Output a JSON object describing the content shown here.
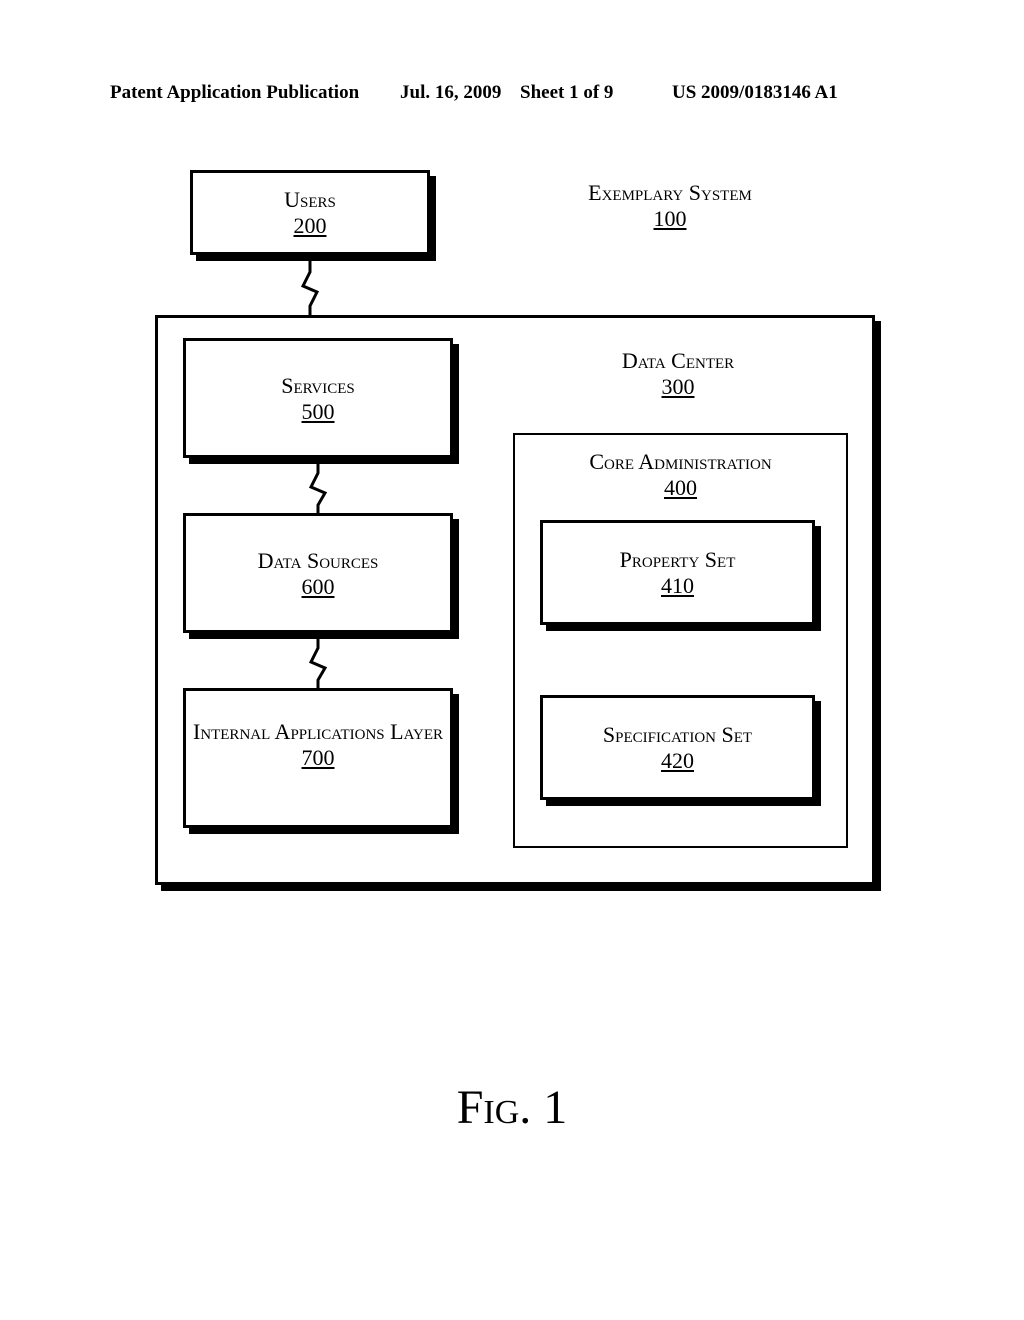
{
  "header": {
    "publication_type": "Patent Application Publication",
    "date": "Jul. 16, 2009",
    "sheet": "Sheet 1 of 9",
    "pubnum": "US 2009/0183146 A1"
  },
  "diagram": {
    "users": {
      "label": "Users",
      "ref": "200"
    },
    "exemplary_system": {
      "label": "Exemplary System",
      "ref": "100"
    },
    "data_center": {
      "label": "Data Center",
      "ref": "300"
    },
    "services": {
      "label": "Services",
      "ref": "500"
    },
    "data_sources": {
      "label": "Data Sources",
      "ref": "600"
    },
    "internal_apps": {
      "label": "Internal Applications Layer",
      "ref": "700"
    },
    "core_admin": {
      "label": "Core Administration",
      "ref": "400"
    },
    "property_set": {
      "label": "Property Set",
      "ref": "410"
    },
    "specification_set": {
      "label": "Specification Set",
      "ref": "420"
    }
  },
  "figure_caption": "Fig. 1"
}
